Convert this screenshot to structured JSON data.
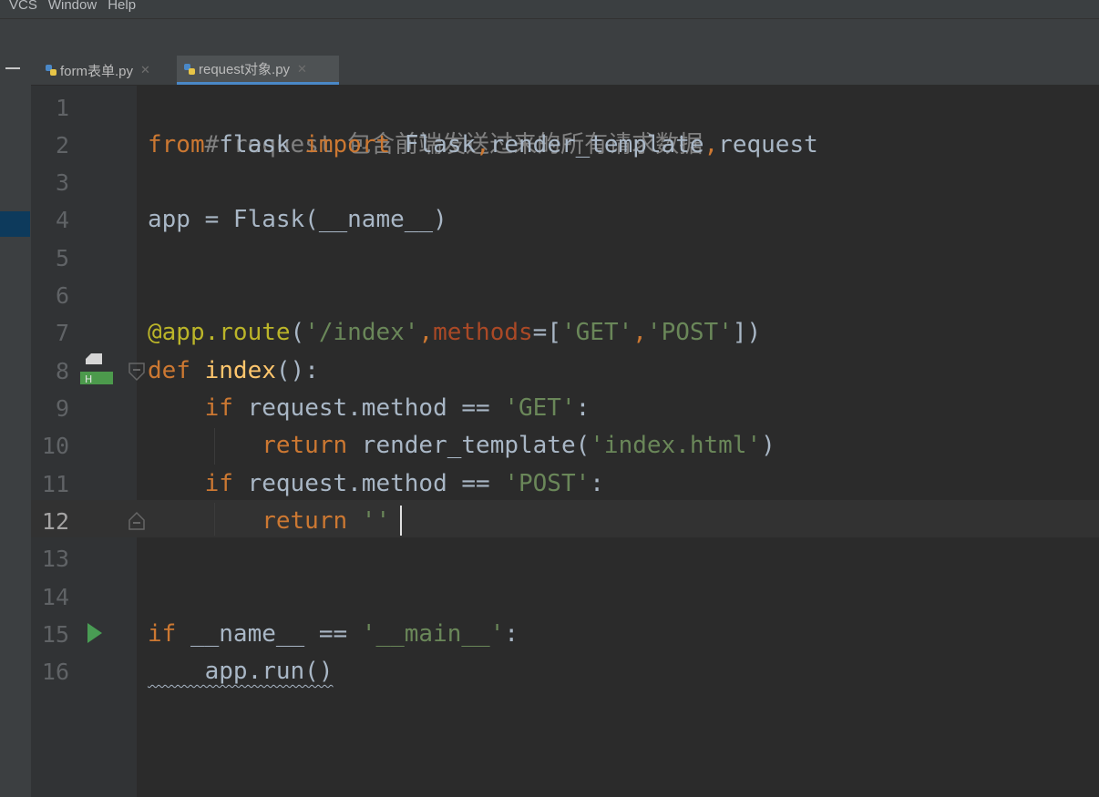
{
  "menu": [
    "VCS",
    "Window",
    "Help"
  ],
  "tabs": [
    {
      "label": "form表单.py",
      "active": false
    },
    {
      "label": "request对象.py",
      "active": true
    }
  ],
  "editor": {
    "line_numbers": [
      "1",
      "2",
      "3",
      "4",
      "5",
      "6",
      "7",
      "8",
      "9",
      "10",
      "11",
      "12",
      "13",
      "14",
      "15",
      "16"
    ],
    "current_line": "12",
    "code": {
      "l1_comment": "# request 包含前端发送过来的所有请求数据",
      "l2_from": "from",
      "l2_module": " flask ",
      "l2_import": "import",
      "l2_names_1": " Flask",
      "l2_comma_1": ",",
      "l2_names_2": "render_template",
      "l2_comma_2": ",",
      "l2_names_3": "request",
      "l4_app": "app = Flask(__name__)",
      "l7_decorator": "@app.route",
      "l7_open": "(",
      "l7_route": "'/index'",
      "l7_comma_1": ",",
      "l7_param": "methods",
      "l7_eq": "=[",
      "l7_get": "'GET'",
      "l7_comma_2": ",",
      "l7_post": "'POST'",
      "l7_close": "])",
      "l8_def": "def",
      "l8_name": " index",
      "l8_rest": "():",
      "l9_if": "    if",
      "l9_cond": " request.method == ",
      "l9_str": "'GET'",
      "l9_colon": ":",
      "l10_return": "        return",
      "l10_call": " render_template(",
      "l10_str": "'index.html'",
      "l10_close": ")",
      "l11_if": "    if",
      "l11_cond": " request.method == ",
      "l11_str": "'POST'",
      "l11_colon": ":",
      "l12_return": "        return",
      "l12_str": " ''",
      "l15_if": "if",
      "l15_cond": " __name__ == ",
      "l15_str": "'__main__'",
      "l15_colon": ":",
      "l16_call": "    app.run()"
    }
  },
  "colors": {
    "keyword": "#cc7832",
    "string": "#6a8759",
    "comment": "#808080",
    "decorator": "#bbb529",
    "function": "#ffc66d",
    "text": "#a9b7c6",
    "run_icon": "#499c54"
  },
  "icons": {
    "collapse": "minus-icon",
    "python_file": "python-file-icon",
    "implements": "implements-marker-icon",
    "run": "run-gutter-icon",
    "fold": "fold-marker-icon"
  }
}
